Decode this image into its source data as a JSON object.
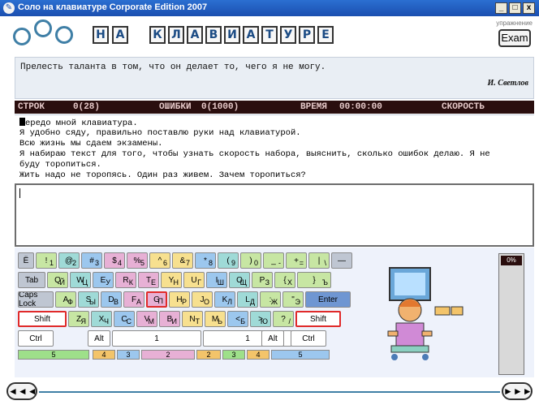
{
  "window": {
    "title": "Соло на клавиатуре Corporate Edition 2007",
    "controls": [
      "_",
      "□",
      "x"
    ]
  },
  "header": {
    "brand_letters": [
      "Н",
      "А",
      "К",
      "Л",
      "А",
      "В",
      "И",
      "А",
      "Т",
      "У",
      "Р",
      "Е"
    ],
    "mode_label": "упражнение",
    "exam_button": "Exam"
  },
  "quote": {
    "text": "Прелесть таланта в том, что он делает то, чего я не могу.",
    "author": "И. Светлов"
  },
  "stats": {
    "lines_label": "СТРОК",
    "lines_value": "0(28)",
    "errors_label": "ОШИБКИ",
    "errors_value": "0(1000)",
    "time_label": "ВРЕМЯ",
    "time_value": "00:00:00",
    "speed_label": "СКОРОСТЬ"
  },
  "lesson": {
    "lines": [
      "ередо мной клавиатура.",
      "Я удобно сяду, правильно поставлю руки над клавиатурой.",
      "Всю жизнь мы сдаем экзамены.",
      "Я набираю текст для того, чтобы узнать скорость набора, выяснить, сколько ошибок делаю. Я не",
      "буду торопиться.",
      "Жить надо не торопясь. Один раз живем. Зачем торопиться?"
    ]
  },
  "keyboard": {
    "row1": [
      {
        "top": "Ё",
        "bottom": "",
        "color": "grey"
      },
      {
        "top": "!",
        "bottom": "1",
        "color": "green"
      },
      {
        "top": "@",
        "bottom": "2",
        "color": "teal"
      },
      {
        "top": "#",
        "bottom": "3",
        "color": "blue"
      },
      {
        "top": "$",
        "bottom": "4",
        "color": "pink"
      },
      {
        "top": "%",
        "bottom": "5",
        "color": "pink"
      },
      {
        "top": "^",
        "bottom": "6",
        "color": "yellow"
      },
      {
        "top": "&",
        "bottom": "7",
        "color": "yellow"
      },
      {
        "top": "*",
        "bottom": "8",
        "color": "blue"
      },
      {
        "top": "(",
        "bottom": "9",
        "color": "teal"
      },
      {
        "top": ")",
        "bottom": "0",
        "color": "green"
      },
      {
        "top": "_",
        "bottom": "-",
        "color": "green"
      },
      {
        "top": "+",
        "bottom": "=",
        "color": "green"
      },
      {
        "top": "|",
        "bottom": "\\",
        "color": "green"
      },
      {
        "top": "—",
        "bottom": "",
        "color": "grey"
      }
    ],
    "row2": [
      {
        "label": "Tab",
        "color": "grey"
      },
      {
        "top": "Q",
        "bottom": "Й",
        "color": "green"
      },
      {
        "top": "W",
        "bottom": "Ц",
        "color": "teal"
      },
      {
        "top": "E",
        "bottom": "У",
        "color": "blue"
      },
      {
        "top": "R",
        "bottom": "К",
        "color": "pink"
      },
      {
        "top": "T",
        "bottom": "Е",
        "color": "pink"
      },
      {
        "top": "Y",
        "bottom": "Н",
        "color": "yellow"
      },
      {
        "top": "U",
        "bottom": "Г",
        "color": "yellow"
      },
      {
        "top": "I",
        "bottom": "Ш",
        "color": "blue"
      },
      {
        "top": "O",
        "bottom": "Щ",
        "color": "teal"
      },
      {
        "top": "P",
        "bottom": "З",
        "color": "green"
      },
      {
        "top": "{",
        "bottom": "Х",
        "color": "green"
      },
      {
        "top": "}",
        "bottom": "Ъ",
        "color": "green"
      }
    ],
    "row3": [
      {
        "label": "Caps Lock",
        "color": "grey"
      },
      {
        "top": "A",
        "bottom": "Ф",
        "color": "green"
      },
      {
        "top": "S",
        "bottom": "Ы",
        "color": "teal"
      },
      {
        "top": "D",
        "bottom": "В",
        "color": "blue"
      },
      {
        "top": "F",
        "bottom": "А",
        "color": "pink"
      },
      {
        "top": "G",
        "bottom": "П",
        "color": "pink",
        "highlight": true
      },
      {
        "top": "H",
        "bottom": "Р",
        "color": "yellow"
      },
      {
        "top": "J",
        "bottom": "О",
        "color": "yellow"
      },
      {
        "top": "K",
        "bottom": "Л",
        "color": "blue"
      },
      {
        "top": "L",
        "bottom": "Д",
        "color": "teal"
      },
      {
        "top": ":",
        "bottom": "Ж",
        "color": "green"
      },
      {
        "top": "\"",
        "bottom": "Э",
        "color": "green"
      },
      {
        "label": "Enter",
        "color": "darkblue"
      }
    ],
    "row4": [
      {
        "label": "Shift",
        "color": "white",
        "highlight": true
      },
      {
        "top": "Z",
        "bottom": "Я",
        "color": "green"
      },
      {
        "top": "X",
        "bottom": "Ч",
        "color": "teal"
      },
      {
        "top": "C",
        "bottom": "С",
        "color": "blue"
      },
      {
        "top": "V",
        "bottom": "М",
        "color": "pink"
      },
      {
        "top": "B",
        "bottom": "И",
        "color": "pink"
      },
      {
        "top": "N",
        "bottom": "Т",
        "color": "yellow"
      },
      {
        "top": "M",
        "bottom": "Ь",
        "color": "yellow"
      },
      {
        "top": "<",
        "bottom": "Б",
        "color": "blue"
      },
      {
        "top": ">",
        "bottom": "Ю",
        "color": "teal"
      },
      {
        "top": "?",
        "bottom": "/",
        "color": "green"
      },
      {
        "label": "Shift",
        "color": "white",
        "highlight": true
      }
    ],
    "row5": [
      {
        "label": "Ctrl",
        "color": "white"
      },
      {
        "label": "Alt",
        "color": "white"
      },
      {
        "label": "1",
        "color": "white"
      },
      {
        "label": "1",
        "color": "white"
      },
      {
        "label": "Alt",
        "color": "white"
      },
      {
        "label": "Ctrl",
        "color": "white"
      }
    ],
    "fingers": [
      "5",
      "4",
      "3",
      "2",
      "2",
      "3",
      "4",
      "5"
    ]
  },
  "gauge": {
    "label": "0%"
  },
  "nav": {
    "prev": "◄◄◄",
    "next": "►►►"
  }
}
